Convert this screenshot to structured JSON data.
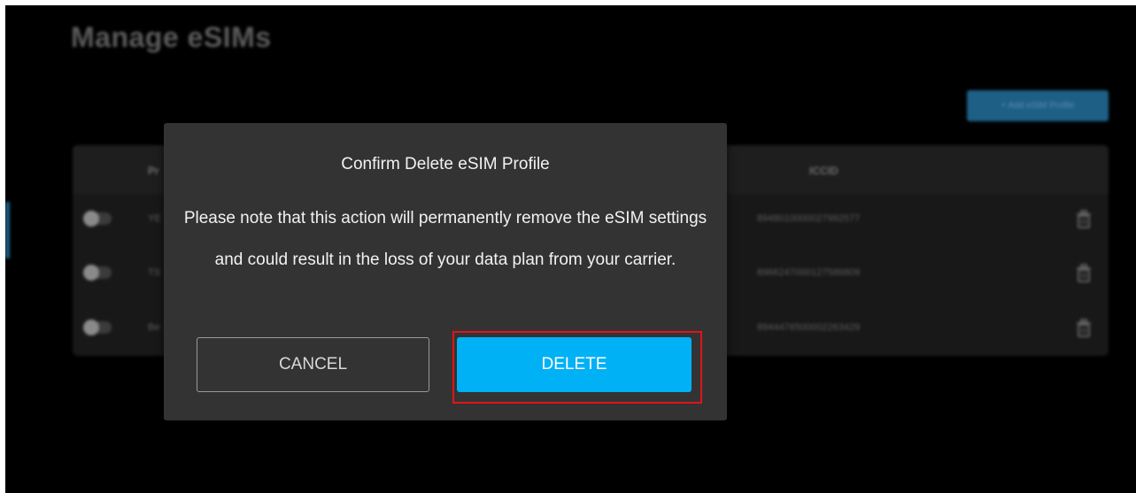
{
  "page": {
    "title": "Manage eSIMs",
    "add_button_label": "+ Add eSIM Profile"
  },
  "table": {
    "columns": {
      "profile": "Pr",
      "iccid": "ICCID"
    },
    "rows": [
      {
        "name": "YE",
        "iccid": "8948010000027992577",
        "enabled": false,
        "delete_icon": "trash-icon"
      },
      {
        "name": "TS",
        "iccid": "8966247000127586809",
        "enabled": false,
        "delete_icon": "trash-icon"
      },
      {
        "name": "Be",
        "iccid": "8944476500002263429",
        "enabled": false,
        "delete_icon": "trash-icon"
      }
    ]
  },
  "dialog": {
    "title": "Confirm Delete eSIM Profile",
    "message": "Please note that this action will permanently remove the eSIM settings and could result in the loss of your data plan from your carrier.",
    "cancel_label": "CANCEL",
    "delete_label": "DELETE"
  },
  "colors": {
    "screen_background": "#000000",
    "dialog_background": "#333333",
    "delete_button": "#00b1f5",
    "highlight_annotation": "#e0141a",
    "add_button": "#1e5f86"
  }
}
